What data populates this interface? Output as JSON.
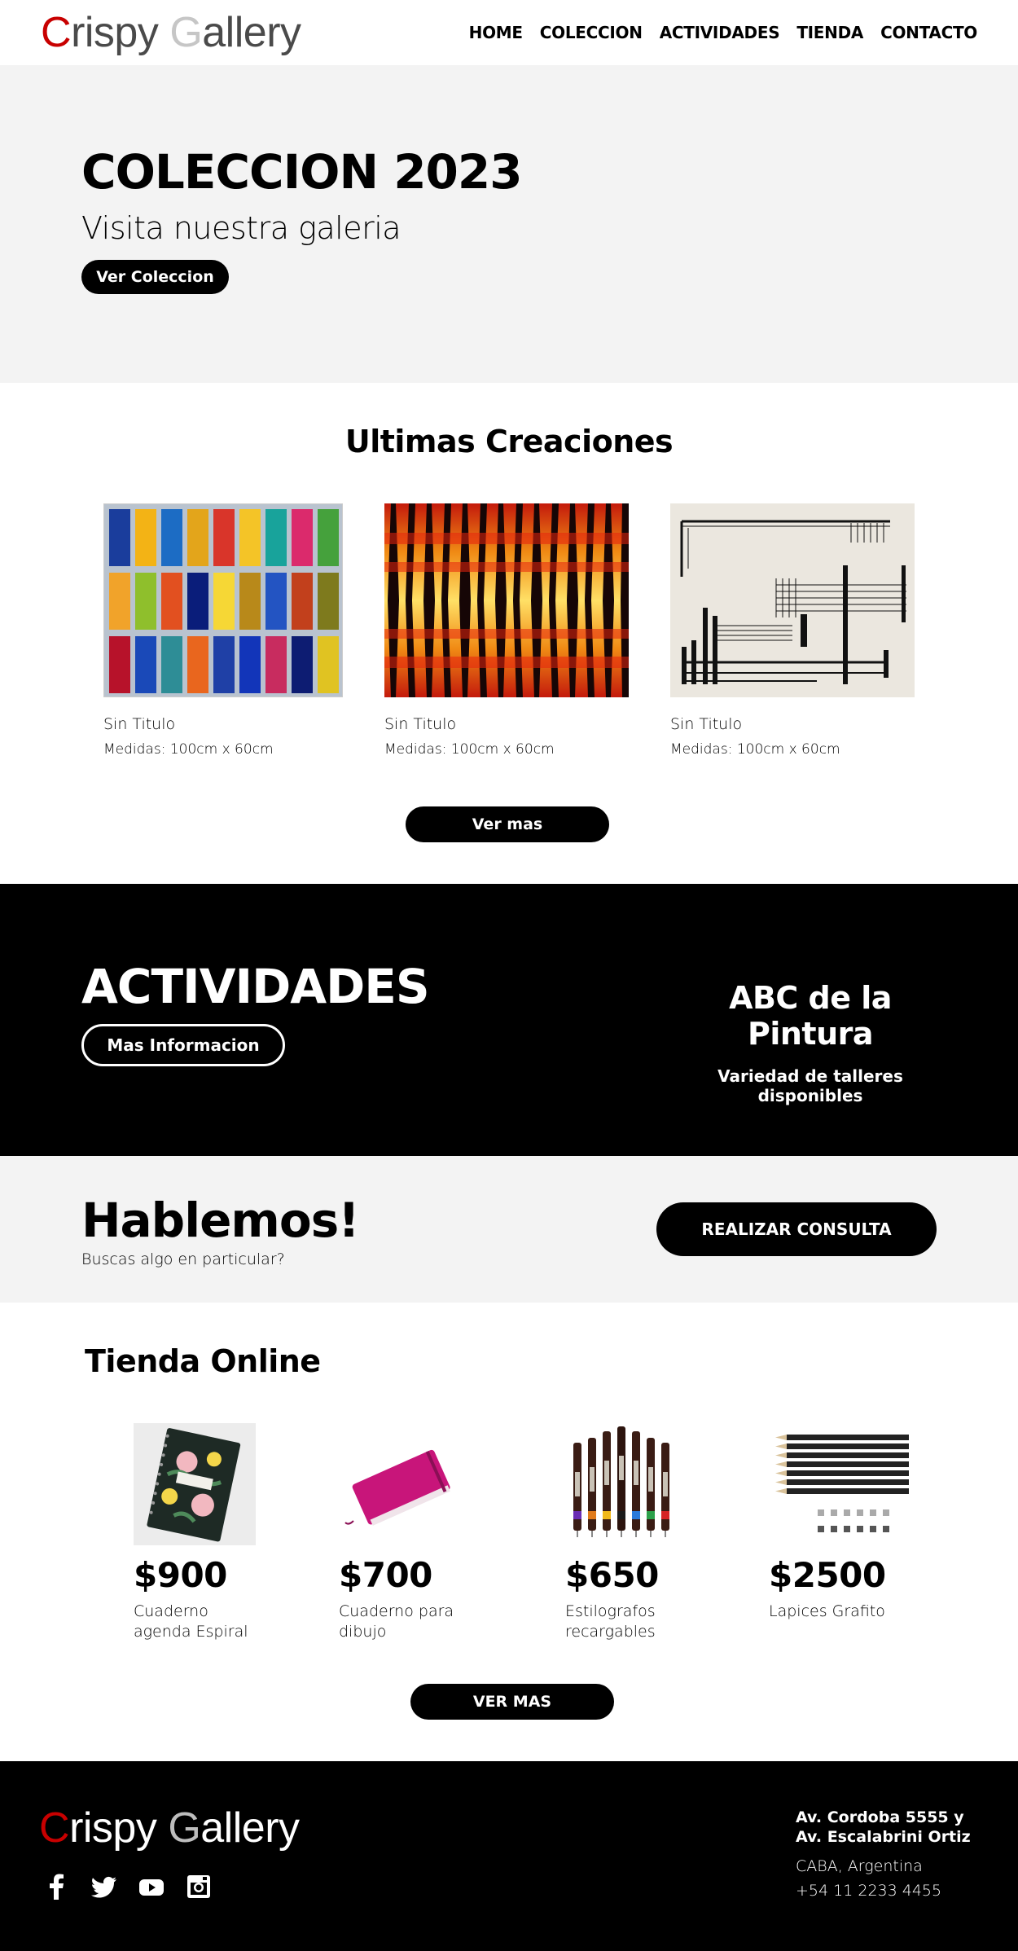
{
  "header": {
    "logo": {
      "first_initial": "C",
      "first_rest": "rispy ",
      "second_initial": "G",
      "second_rest": "allery"
    },
    "nav": [
      "HOME",
      "COLECCION",
      "ACTIVIDADES",
      "TIENDA",
      "CONTACTO"
    ]
  },
  "hero": {
    "title": "COLECCION 2023",
    "subtitle": "Visita nuestra galeria",
    "button": "Ver Coleccion"
  },
  "creaciones": {
    "title": "Ultimas Creaciones",
    "items": [
      {
        "name": "Sin Titulo",
        "measures": "Medidas: 100cm x 60cm"
      },
      {
        "name": "Sin Titulo",
        "measures": "Medidas: 100cm x 60cm"
      },
      {
        "name": "Sin Titulo",
        "measures": "Medidas: 100cm x 60cm"
      }
    ],
    "button": "Ver mas"
  },
  "actividades": {
    "title": "ACTIVIDADES",
    "button": "Mas Informacion",
    "feature_title": "ABC de la Pintura",
    "feature_subtitle": "Variedad de talleres disponibles"
  },
  "hablemos": {
    "title": "Hablemos!",
    "subtitle": "Buscas algo en particular?",
    "button": "REALIZAR CONSULTA"
  },
  "tienda": {
    "title": "Tienda Online",
    "products": [
      {
        "price": "$900",
        "name": "Cuaderno agenda Espiral"
      },
      {
        "price": "$700",
        "name": "Cuaderno para dibujo"
      },
      {
        "price": "$650",
        "name": "Estilografos recargables"
      },
      {
        "price": "$2500",
        "name": "Lapices Grafito"
      }
    ],
    "button": "VER MAS"
  },
  "footer": {
    "address_line1": "Av. Cordoba 5555 y",
    "address_line2": "Av. Escalabrini Ortiz",
    "city": "CABA, Argentina",
    "phone": "+54 11 2233 4455",
    "socials": [
      "facebook-icon",
      "twitter-icon",
      "youtube-icon",
      "instagram-icon"
    ]
  },
  "colors": {
    "brand_red": "#c80000",
    "logo_gray": "#4a4a4a",
    "light_section": "#f3f3f3",
    "dark_section": "#000000"
  }
}
